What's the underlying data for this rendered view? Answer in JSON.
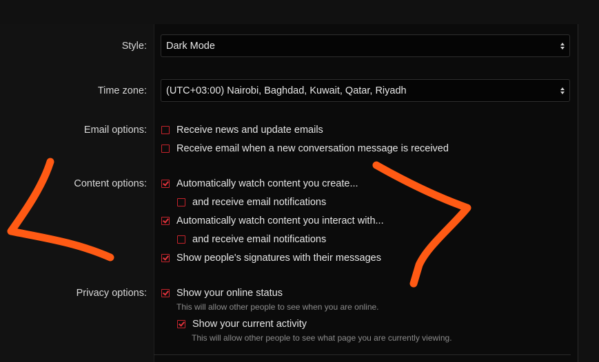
{
  "style": {
    "label": "Style:",
    "value": "Dark Mode"
  },
  "timezone": {
    "label": "Time zone:",
    "value": "(UTC+03:00) Nairobi, Baghdad, Kuwait, Qatar, Riyadh"
  },
  "email_options": {
    "label": "Email options:",
    "items": [
      {
        "text": "Receive news and update emails",
        "checked": false
      },
      {
        "text": "Receive email when a new conversation message is received",
        "checked": false
      }
    ]
  },
  "content_options": {
    "label": "Content options:",
    "items": [
      {
        "text": "Automatically watch content you create...",
        "checked": true
      },
      {
        "text": "and receive email notifications",
        "checked": false
      },
      {
        "text": "Automatically watch content you interact with...",
        "checked": true
      },
      {
        "text": "and receive email notifications",
        "checked": false
      },
      {
        "text": "Show people's signatures with their messages",
        "checked": true
      }
    ]
  },
  "privacy_options": {
    "label": "Privacy options:",
    "items": [
      {
        "text": "Show your online status",
        "hint": "This will allow other people to see when you are online.",
        "checked": true
      },
      {
        "text": "Show your current activity",
        "hint": "This will allow other people to see what page you are currently viewing.",
        "checked": true
      }
    ]
  },
  "colors": {
    "accent": "#c8242c",
    "annotation": "#ff5a14",
    "background": "#0b0b0b"
  }
}
